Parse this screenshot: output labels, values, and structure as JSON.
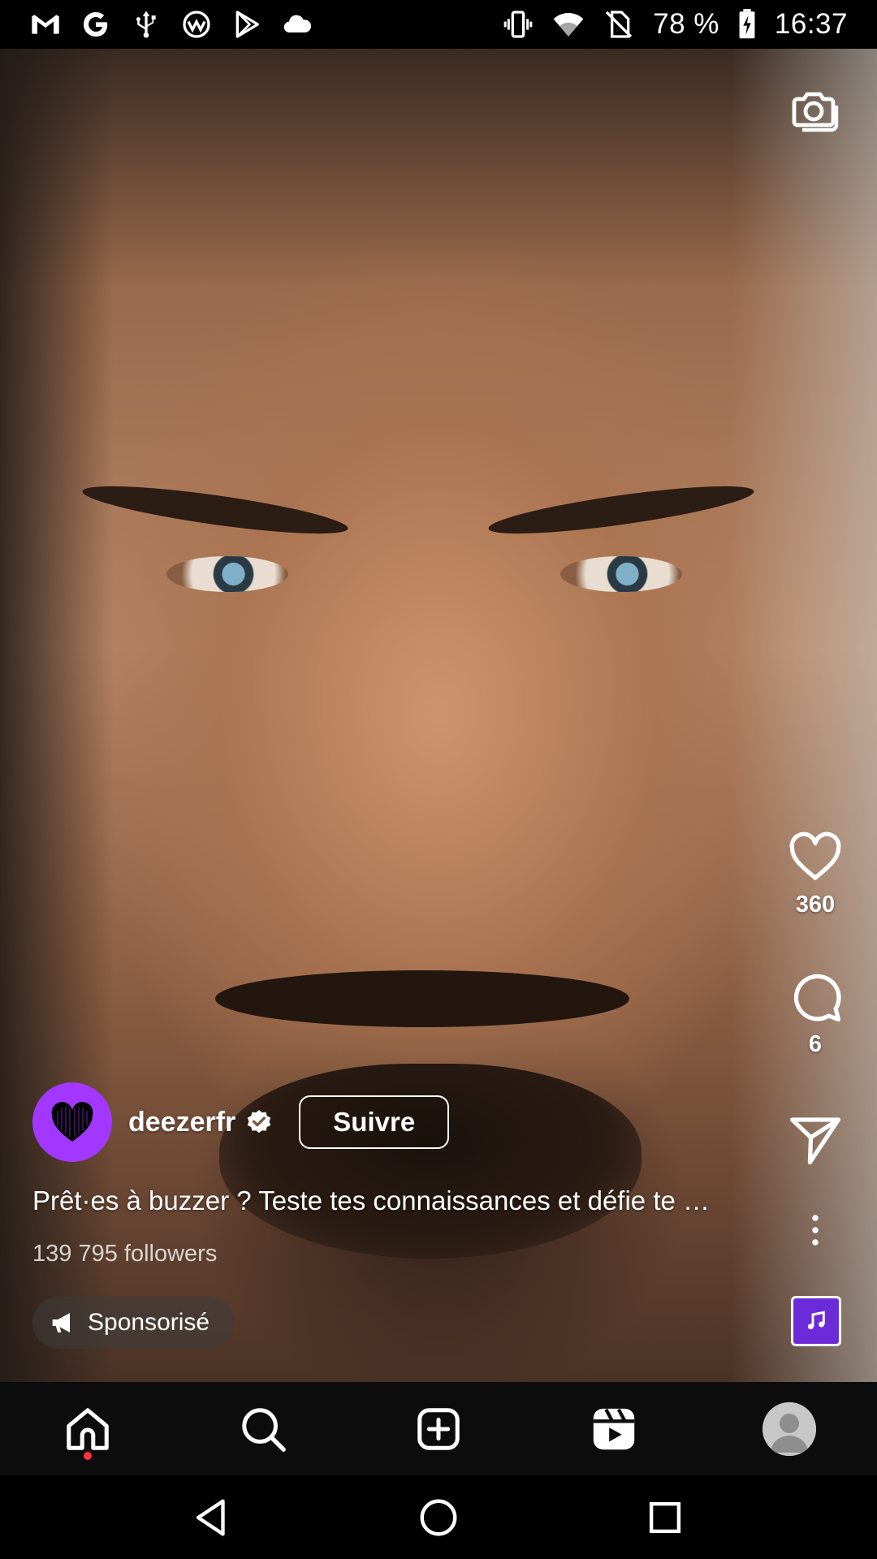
{
  "status_bar": {
    "battery_percent": "78 %",
    "time": "16:37",
    "left_icons": [
      "gmail-icon",
      "google-icon",
      "usb-icon",
      "vpn-icon",
      "play-store-icon",
      "cloud-icon"
    ],
    "right_icons": [
      "vibrate-icon",
      "wifi-icon",
      "no-sim-icon",
      "battery-charging-icon"
    ]
  },
  "post": {
    "account": {
      "username": "deezerfr",
      "verified": true,
      "follow_label": "Suivre",
      "avatar_color": "#a238ff"
    },
    "caption": "Prêt·es à buzzer ? Teste tes connaissances et défie te …",
    "followers": "139 795 followers",
    "sponsored_label": "Sponsorisé",
    "likes": "360",
    "comments": "6"
  },
  "bottom_nav": {
    "items": [
      "home",
      "search",
      "create",
      "reels",
      "profile"
    ],
    "active": "home",
    "notification_dot_color": "#ff3040"
  },
  "system_nav": [
    "back",
    "home",
    "recents"
  ],
  "colors": {
    "brand_purple": "#a238ff",
    "nav_background": "#0c0c0c"
  }
}
